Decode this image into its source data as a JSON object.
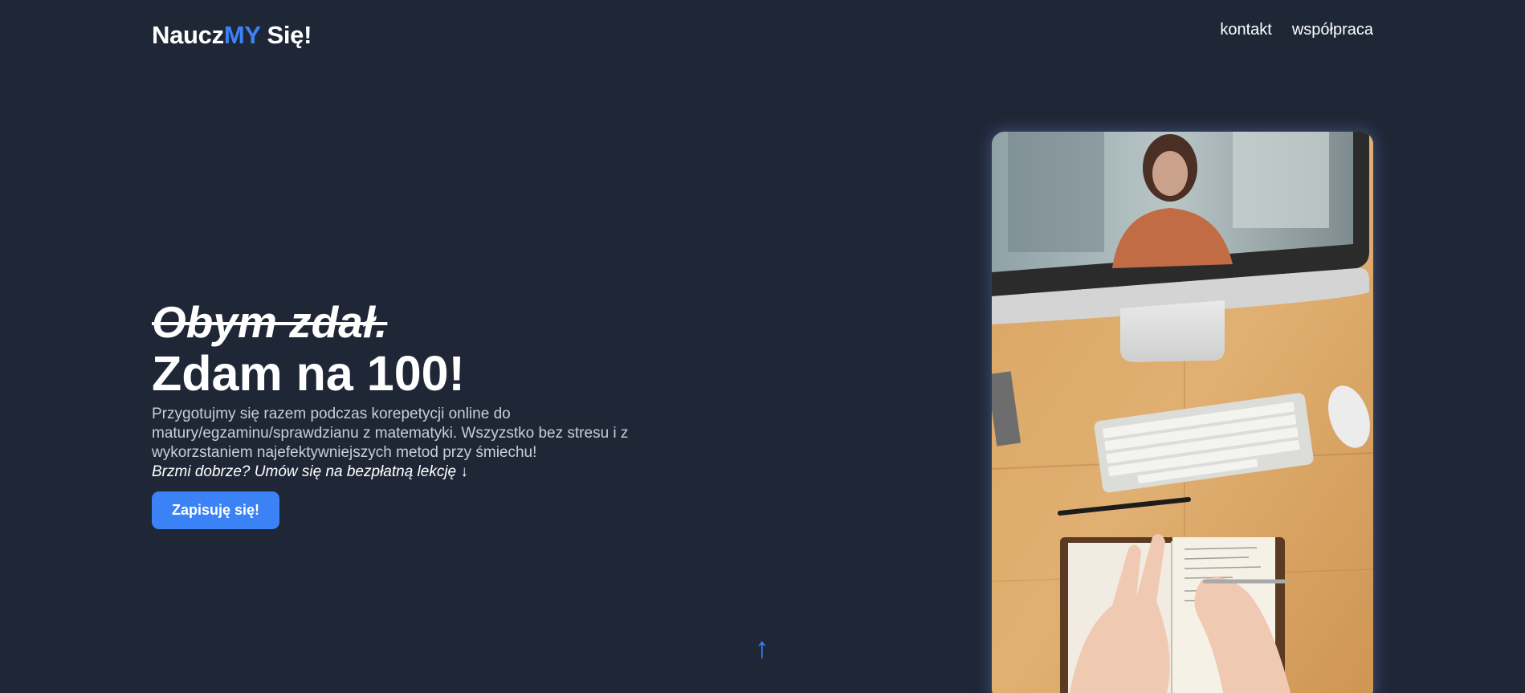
{
  "header": {
    "logo": {
      "part1": "Naucz",
      "part2": "MY",
      "part3": " Się!"
    },
    "nav": [
      {
        "label": "kontakt"
      },
      {
        "label": "współpraca"
      }
    ]
  },
  "hero": {
    "struck_text": "Obym zdał.",
    "title": "Zdam na 100!",
    "description": "Przygotujmy się razem podczas korepetycji online do matury/egzaminu/sprawdzianu z matematyki. Wszyzstko bez stresu i z wykorzstaniem najefektywniejszych metod przy śmiechu!",
    "cta_text": "Brzmi dobrze? Umów się na bezpłatną lekcję ↓",
    "button_label": "Zapisuję się!"
  },
  "scroll_arrow": "↑",
  "icons": {
    "scroll": "arrow-up-icon"
  },
  "colors": {
    "background": "#1f2737",
    "accent": "#3b82f6"
  }
}
